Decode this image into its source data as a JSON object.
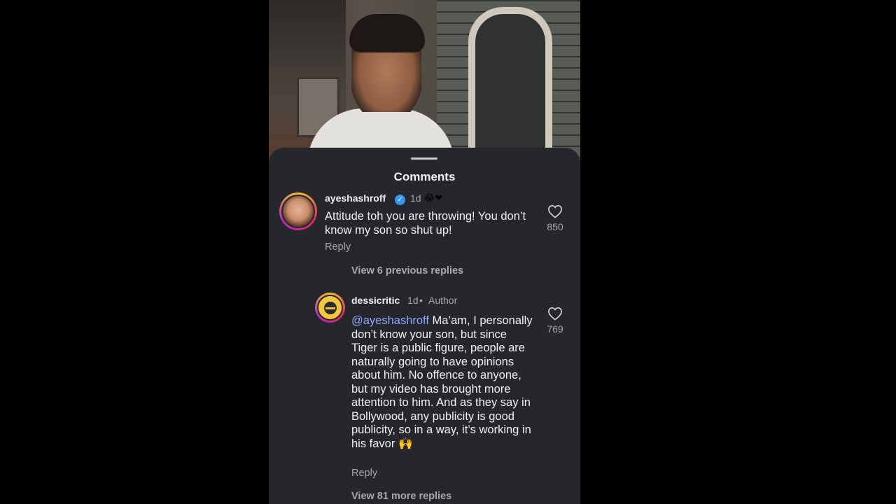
{
  "sheet": {
    "title": "Comments"
  },
  "comments": [
    {
      "username": "ayeshashroff",
      "time": "1d",
      "emoji": "😂❤",
      "text": "Attitude toh you are throwing! You don’t know my son so shut up!",
      "reply_label": "Reply",
      "likes": "850",
      "view_previous": "View 6 previous replies"
    },
    {
      "username": "dessicritic",
      "time": "1d",
      "author_label": "Author",
      "mention": "@ayeshashroff",
      "text": " Ma’am, I personally don’t know your son, but since Tiger is a public figure, people are naturally going to have opinions about him. No offence to anyone, but my video has brought more attention to him. And as they say in Bollywood, any publicity is good publicity, so in a way, it’s working in his favor 🙌",
      "reply_label": "Reply",
      "likes": "769",
      "view_more": "View 81 more replies"
    }
  ],
  "icons": {
    "verified": "verified-badge-icon",
    "like": "heart-icon"
  },
  "colors": {
    "sheet_bg": "#25272c",
    "mention": "#8fa8ff",
    "verified": "#3897f0"
  }
}
